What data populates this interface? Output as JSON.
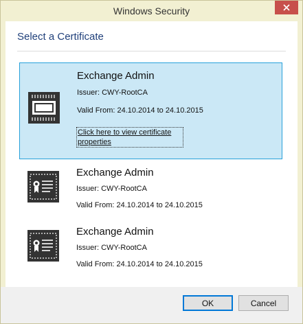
{
  "window": {
    "title": "Windows Security"
  },
  "dialog": {
    "heading": "Select a Certificate"
  },
  "certificates": [
    {
      "name": "Exchange Admin",
      "issuer": "Issuer: CWY-RootCA",
      "valid": "Valid From: 24.10.2014 to 24.10.2015",
      "link": "Click here to view certificate properties",
      "selected": true,
      "icon": "chip-certificate-icon"
    },
    {
      "name": "Exchange Admin",
      "issuer": "Issuer: CWY-RootCA",
      "valid": "Valid From: 24.10.2014 to 24.10.2015",
      "selected": false,
      "icon": "certificate-icon"
    },
    {
      "name": "Exchange Admin",
      "issuer": "Issuer: CWY-RootCA",
      "valid": "Valid From: 24.10.2014 to 24.10.2015",
      "selected": false,
      "icon": "certificate-icon"
    }
  ],
  "buttons": {
    "ok": "OK",
    "cancel": "Cancel"
  },
  "colors": {
    "frame": "#f2f0d2",
    "close_button": "#c7504b",
    "heading_text": "#1f3f7a",
    "selection_fill": "#cbe8f6",
    "selection_border": "#26a0da",
    "default_button_border": "#0078d7"
  }
}
